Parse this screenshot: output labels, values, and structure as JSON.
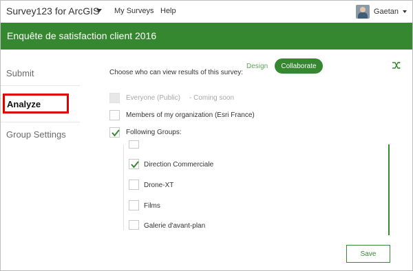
{
  "app": {
    "title": "Survey123 for ArcGIS"
  },
  "nav": {
    "my_surveys": "My Surveys",
    "help": "Help"
  },
  "user": {
    "name": "Gaetan"
  },
  "survey": {
    "title": "Enquête de satisfaction client 2016"
  },
  "sidebar": {
    "items": [
      "Submit",
      "Analyze",
      "Group Settings"
    ],
    "active": "Analyze"
  },
  "main": {
    "prompt": "Choose who can view results of this survey:",
    "mode_tabs": {
      "design": "Design",
      "collaborate": "Collaborate"
    },
    "options": {
      "everyone": "Everyone (Public)",
      "coming_soon": "- Coming soon",
      "members": "Members of my organization (Esri France)",
      "following_groups": "Following Groups:"
    },
    "groups": [
      {
        "label": "Direction Commerciale",
        "checked": true
      },
      {
        "label": "Drone-XT",
        "checked": false
      },
      {
        "label": "Films",
        "checked": false
      },
      {
        "label": "Galerie d'avant-plan",
        "checked": false
      }
    ],
    "save_label": "Save"
  },
  "colors": {
    "brand_green": "#35882f",
    "highlight_red": "#e00000"
  },
  "icons": [
    "app-menu-caret-icon",
    "user-avatar",
    "user-caret-icon",
    "shuffle-icon",
    "checkmark-icon"
  ]
}
